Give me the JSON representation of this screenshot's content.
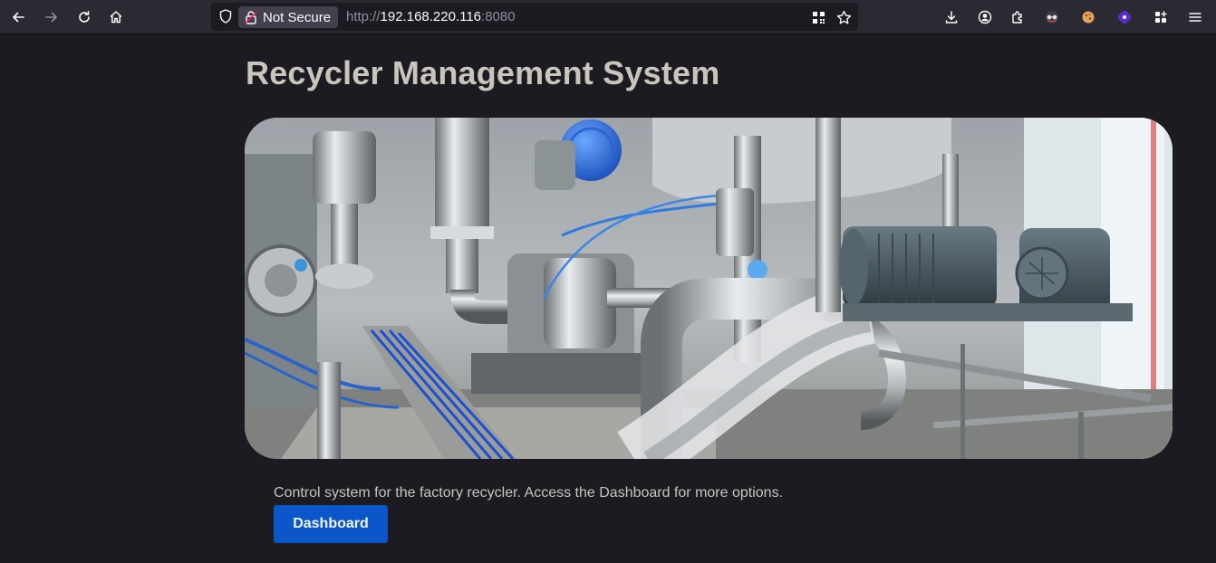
{
  "browser": {
    "security_label": "Not Secure",
    "url_scheme": "http://",
    "url_host": "192.168.220.116",
    "url_port": ":8080"
  },
  "page": {
    "title": "Recycler Management System",
    "hero_image": "factory-recycler-machinery-photo",
    "description": "Control system for the factory recycler. Access the Dashboard for more options.",
    "dashboard_button_label": "Dashboard"
  },
  "colors": {
    "page_background": "#1c1b22",
    "toolbar_background": "#2b2a33",
    "title_text": "#c9c4bc",
    "button_background": "#0b57c9"
  }
}
